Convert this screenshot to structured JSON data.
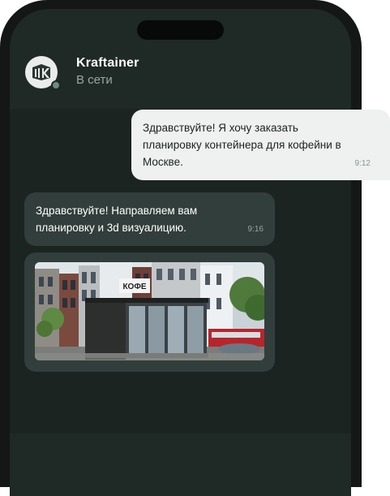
{
  "contact": {
    "name": "Kraftainer",
    "status": "В сети"
  },
  "messages": [
    {
      "direction": "outgoing",
      "text": "Здравствуйте! Я хочу заказать планировку контейнера для кофейни в Москве.",
      "time": "9:12"
    },
    {
      "direction": "incoming",
      "text": "Здравствуйте! Направляем вам планировку и 3d визуалицию.",
      "time": "9:16"
    },
    {
      "direction": "incoming",
      "type": "image",
      "image_description_icon": "coffee-container-render-image",
      "sign_text": "КОФЕ"
    }
  ],
  "colors": {
    "frame": "#141716",
    "screen": "#1f2926",
    "incoming_bubble": "#323e3b",
    "outgoing_bubble": "#eef1ef",
    "online": "#6e8b80"
  }
}
